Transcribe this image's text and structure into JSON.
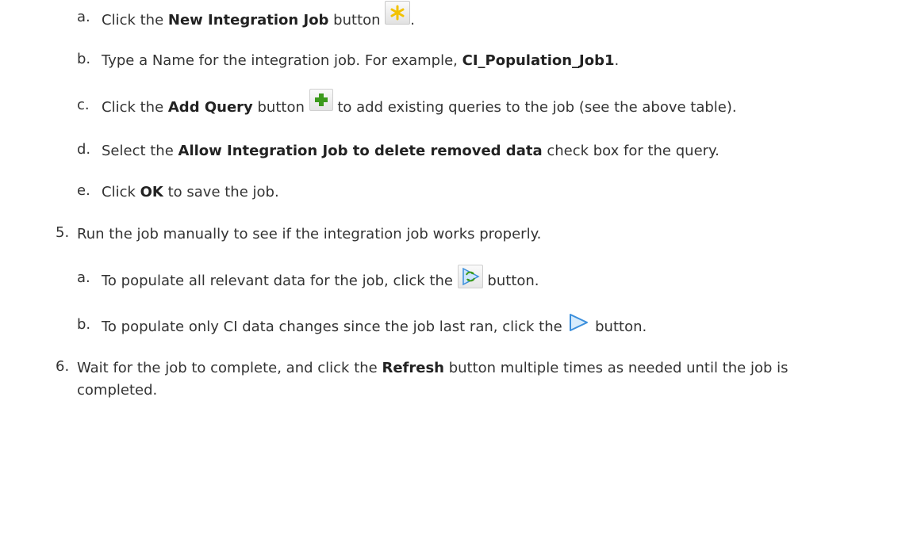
{
  "steps": {
    "step4_substeps": [
      {
        "marker": "a.",
        "pre": "Click the ",
        "bold": "New Integration Job",
        "post": " button",
        "end": "."
      },
      {
        "marker": "b.",
        "pre": "Type a Name for the integration job. For example, ",
        "bold": "CI_Population_Job1",
        "post": "."
      },
      {
        "marker": "c.",
        "pre": "Click the ",
        "bold": "Add Query",
        "post": " button",
        "post2": " to add existing queries to the job (see the above table)."
      },
      {
        "marker": "d.",
        "pre": "Select the ",
        "bold": "Allow Integration Job to delete removed data",
        "post": " check box for the query."
      },
      {
        "marker": "e.",
        "pre": "Click ",
        "bold": "OK",
        "post": " to save the job."
      }
    ],
    "step5": {
      "marker": "5.",
      "text": "Run the job manually to see if the integration job works properly.",
      "substeps": [
        {
          "marker": "a.",
          "pre": "To populate all relevant data for the job, click the ",
          "post": " button."
        },
        {
          "marker": "b.",
          "pre": "To populate only CI data changes since the job last ran, click the ",
          "post": " button."
        }
      ]
    },
    "step6": {
      "marker": "6.",
      "pre": "Wait for the job to complete, and click the ",
      "bold": "Refresh",
      "post": " button multiple times as needed until the job is",
      "cont": "completed."
    }
  },
  "icons": {
    "new_job": "asterisk-icon",
    "add_query": "plus-icon",
    "full_sync": "full-population-icon",
    "delta_sync": "play-triangle-icon"
  },
  "colors": {
    "text": "#333333",
    "asterisk": "#f2c200",
    "plus": "#3c9a1c",
    "arrow": "#3b8fdc"
  }
}
